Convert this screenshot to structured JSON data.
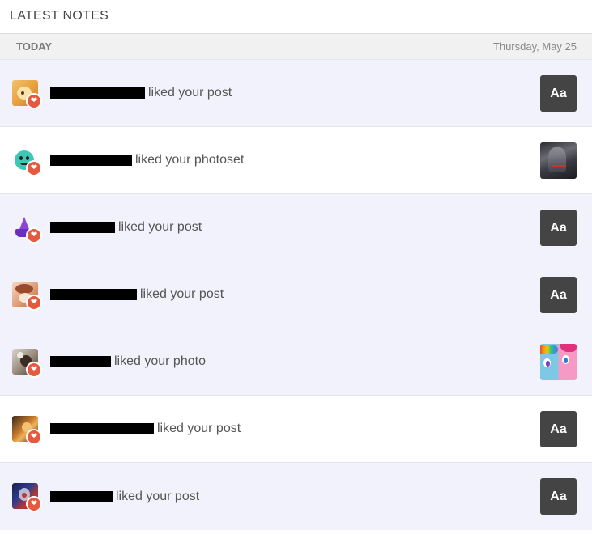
{
  "header": {
    "title": "LATEST NOTES"
  },
  "day": {
    "label": "TODAY",
    "date": "Thursday, May 25"
  },
  "notes": [
    {
      "action": "liked your post",
      "thumb_label": "Aa"
    },
    {
      "action": "liked your photoset",
      "thumb_label": ""
    },
    {
      "action": "liked your post",
      "thumb_label": "Aa"
    },
    {
      "action": "liked your post",
      "thumb_label": "Aa"
    },
    {
      "action": "liked your photo",
      "thumb_label": ""
    },
    {
      "action": "liked your post",
      "thumb_label": "Aa"
    },
    {
      "action": "liked your post",
      "thumb_label": "Aa"
    }
  ],
  "icons": {
    "badge": "heart-icon",
    "thumb_text": "text-post-icon"
  },
  "colors": {
    "heart_badge": "#e5593f",
    "row_shaded": "#f2f2fd",
    "text_thumb": "#444444"
  }
}
